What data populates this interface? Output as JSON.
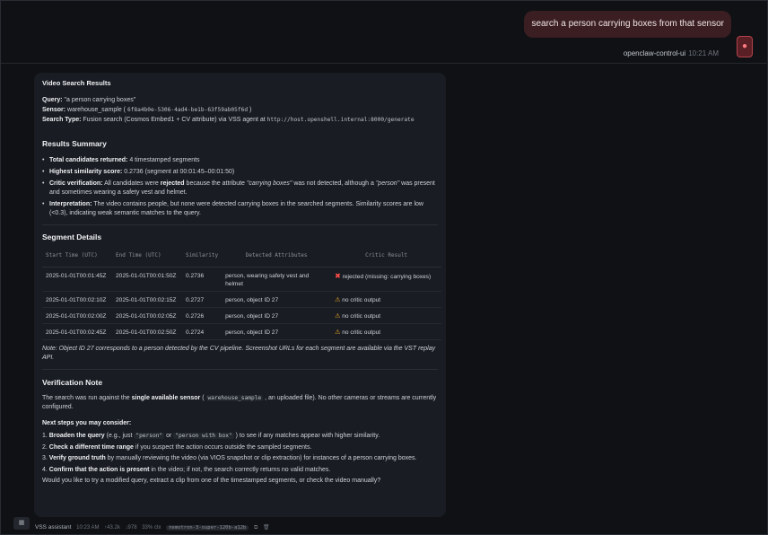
{
  "user_message": {
    "text": "search a person carrying boxes from that sensor",
    "sender": "openclaw-control-ui",
    "time": "10:21 AM"
  },
  "assistant": {
    "title": "Video Search Results",
    "query_label": "Query:",
    "query_value": "\"a person carrying boxes\"",
    "sensor_label": "Sensor:",
    "sensor_value": "warehouse_sample (",
    "sensor_id": "6f8a4b0e-5306-4ad4-be1b-63f59ab05f6d",
    "sensor_close": ")",
    "search_type_label": "Search Type:",
    "search_type_value": "Fusion search (Cosmos Embed1 + CV attribute) via VSS agent at",
    "search_type_url": "http://host.openshell.internal:8000/generate",
    "summary_heading": "Results Summary",
    "summary": {
      "total_label": "Total candidates returned:",
      "total_value": "4 timestamped segments",
      "highest_label": "Highest similarity score:",
      "highest_value": "0.2736 (segment at 00:01:45–00:01:50)",
      "critic_label": "Critic verification:",
      "critic_pre": "All candidates were",
      "critic_rejected": "rejected",
      "critic_mid": "because the attribute",
      "critic_attr": "\"carrying boxes\"",
      "critic_mid2": "was not detected, although a",
      "critic_person": "\"person\"",
      "critic_post": "was present and sometimes wearing a safety vest and helmet.",
      "interp_label": "Interpretation:",
      "interp_value": "The video contains people, but none were detected carrying boxes in the searched segments. Similarity scores are low (<0.3), indicating weak semantic matches to the query."
    },
    "segments_heading": "Segment Details",
    "table": {
      "headers": [
        "Start Time (UTC)",
        "End Time (UTC)",
        "Similarity",
        "Detected Attributes",
        "Critic Result"
      ],
      "rows": [
        {
          "start": "2025-01-01T00:01:45Z",
          "end": "2025-01-01T00:01:50Z",
          "sim": "0.2736",
          "attrs": "person, wearing safety vest and helmet",
          "critic": "rejected (missing: carrying boxes)",
          "icon": "x-icon"
        },
        {
          "start": "2025-01-01T00:02:10Z",
          "end": "2025-01-01T00:02:15Z",
          "sim": "0.2727",
          "attrs": "person, object ID 27",
          "critic": "no critic output",
          "icon": "warning-icon"
        },
        {
          "start": "2025-01-01T00:02:00Z",
          "end": "2025-01-01T00:02:05Z",
          "sim": "0.2726",
          "attrs": "person, object ID 27",
          "critic": "no critic output",
          "icon": "warning-icon"
        },
        {
          "start": "2025-01-01T00:02:45Z",
          "end": "2025-01-01T00:02:50Z",
          "sim": "0.2724",
          "attrs": "person, object ID 27",
          "critic": "no critic output",
          "icon": "warning-icon"
        }
      ]
    },
    "table_note": "Note: Object ID 27 corresponds to a person detected by the CV pipeline. Screenshot URLs for each segment are available via the VST replay API.",
    "verification_heading": "Verification Note",
    "verification_pre": "The search was run against the",
    "verification_bold": "single available sensor",
    "verification_open": "(",
    "verification_code": "warehouse_sample",
    "verification_post": ", an uploaded file). No other cameras or streams are currently configured.",
    "next_steps_heading": "Next steps you may consider:",
    "steps": [
      {
        "num": "1.",
        "bold": "Broaden the query",
        "pre": "(e.g., just",
        "code1": "\"person\"",
        "or": "or",
        "code2": "\"person with box\"",
        "post": ") to see if any matches appear with higher similarity."
      },
      {
        "num": "2.",
        "bold": "Check a different time range",
        "post": "if you suspect the action occurs outside the sampled segments."
      },
      {
        "num": "3.",
        "bold": "Verify ground truth",
        "post": "by manually reviewing the video (via VIOS snapshot or clip extraction) for instances of a person carrying boxes."
      },
      {
        "num": "4.",
        "bold": "Confirm that the action is present",
        "post": "in the video; if not, the search correctly returns no valid matches."
      }
    ],
    "closing_question": "Would you like to try a modified query, extract a clip from one of the timestamped segments, or check the video manually?"
  },
  "footer": {
    "name": "VSS assistant",
    "time": "10:23 AM",
    "tokens_in": "↑43.2k",
    "tokens_out": "↓978",
    "ctx": "33% ctx",
    "model": "nemotron-3-super-120b-a12b"
  },
  "icons": {
    "user_avatar": "person-icon",
    "assistant_avatar": "bot-icon",
    "copy": "copy-icon",
    "delete": "trash-icon"
  },
  "colors": {
    "background": "#0f1115",
    "card": "#191c22",
    "user_bubble": "#3a1e22",
    "accent_red": "#b3444c",
    "reject_red": "#ff4d4d",
    "warning_yellow": "#f4b324"
  }
}
